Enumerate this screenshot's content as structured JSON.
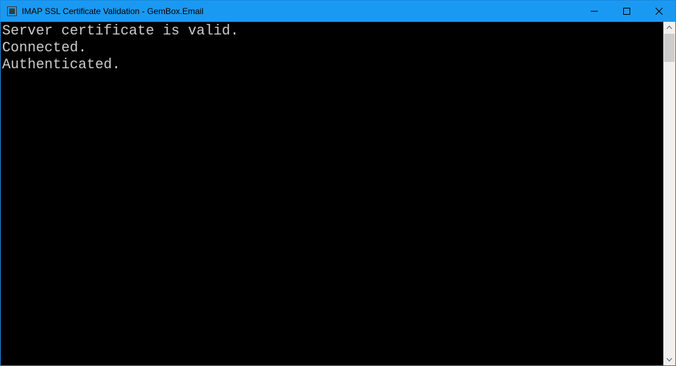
{
  "window": {
    "title": "IMAP SSL Certificate Validation - GemBox.Email"
  },
  "console": {
    "lines": [
      "Server certificate is valid.",
      "Connected.",
      "Authenticated."
    ]
  }
}
